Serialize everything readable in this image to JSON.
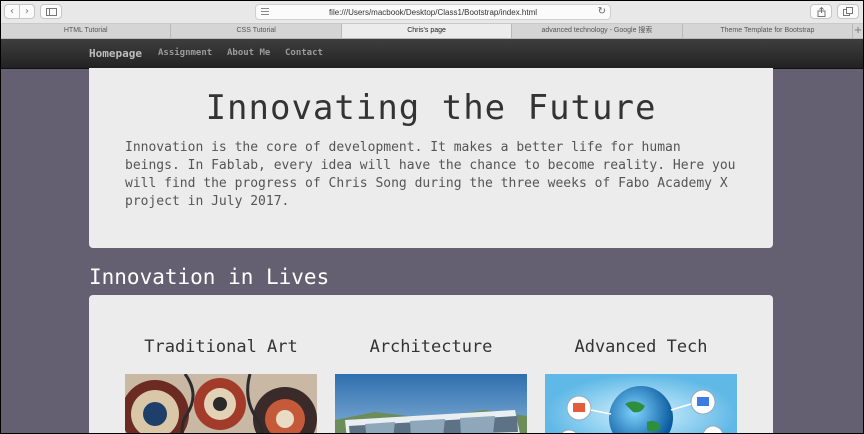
{
  "browser": {
    "url": "file:///Users/macbook/Desktop/Class1/Bootstrap/index.html",
    "back_icon": "chevron-left-icon",
    "forward_icon": "chevron-right-icon",
    "tabs": [
      {
        "label": "HTML Tutorial"
      },
      {
        "label": "CSS Tutorial"
      },
      {
        "label": "Chris's page"
      },
      {
        "label": "advanced technology - Google 搜索"
      },
      {
        "label": "Theme Template for Bootstrap"
      }
    ],
    "active_tab": 2
  },
  "navbar": {
    "brand": "Homepage",
    "links": [
      "Assignment",
      "About Me",
      "Contact"
    ]
  },
  "jumbotron": {
    "title": "Innovating the Future",
    "text": "Innovation is the core of development. It makes a better life for human beings. In Fablab, every idea will have the chance to become reality. Here you will find the progress of Chris Song during the three weeks of Fabo Academy X project in July 2017."
  },
  "section": {
    "heading": "Innovation in Lives",
    "cards": [
      {
        "title": "Traditional Art"
      },
      {
        "title": "Architecture"
      },
      {
        "title": "Advanced Tech"
      }
    ]
  },
  "colors": {
    "page_bg": "#655f72",
    "navbar": "#2b2b2b",
    "panel": "#ececec"
  }
}
